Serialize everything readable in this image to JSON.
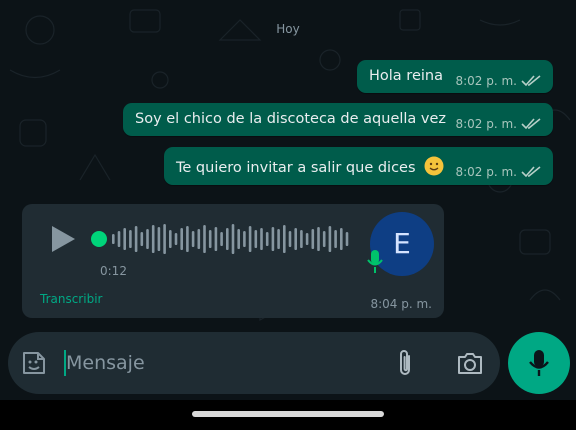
{
  "chat": {
    "date_chip": "Hoy",
    "messages": [
      {
        "text": "Hola reina",
        "time": "8:02 p. m."
      },
      {
        "text": "Soy el chico de la discoteca de aquella vez",
        "time": "8:02 p. m."
      },
      {
        "text": "Te quiero invitar a salir que dices",
        "time": "8:02 p. m."
      }
    ],
    "voice_message": {
      "duration": "0:12",
      "avatar_letter": "E",
      "transcribe_label": "Transcribir",
      "time": "8:04 p. m."
    }
  },
  "composer": {
    "placeholder": "Mensaje"
  },
  "colors": {
    "outgoing_bubble": "#005c4b",
    "incoming_bubble": "#202c33",
    "accent": "#00a884",
    "avatar_bg": "#0e3e84"
  },
  "icons": [
    "emoji-sticker-icon",
    "paperclip-icon",
    "camera-icon",
    "microphone-icon",
    "play-icon",
    "double-check-icon"
  ]
}
